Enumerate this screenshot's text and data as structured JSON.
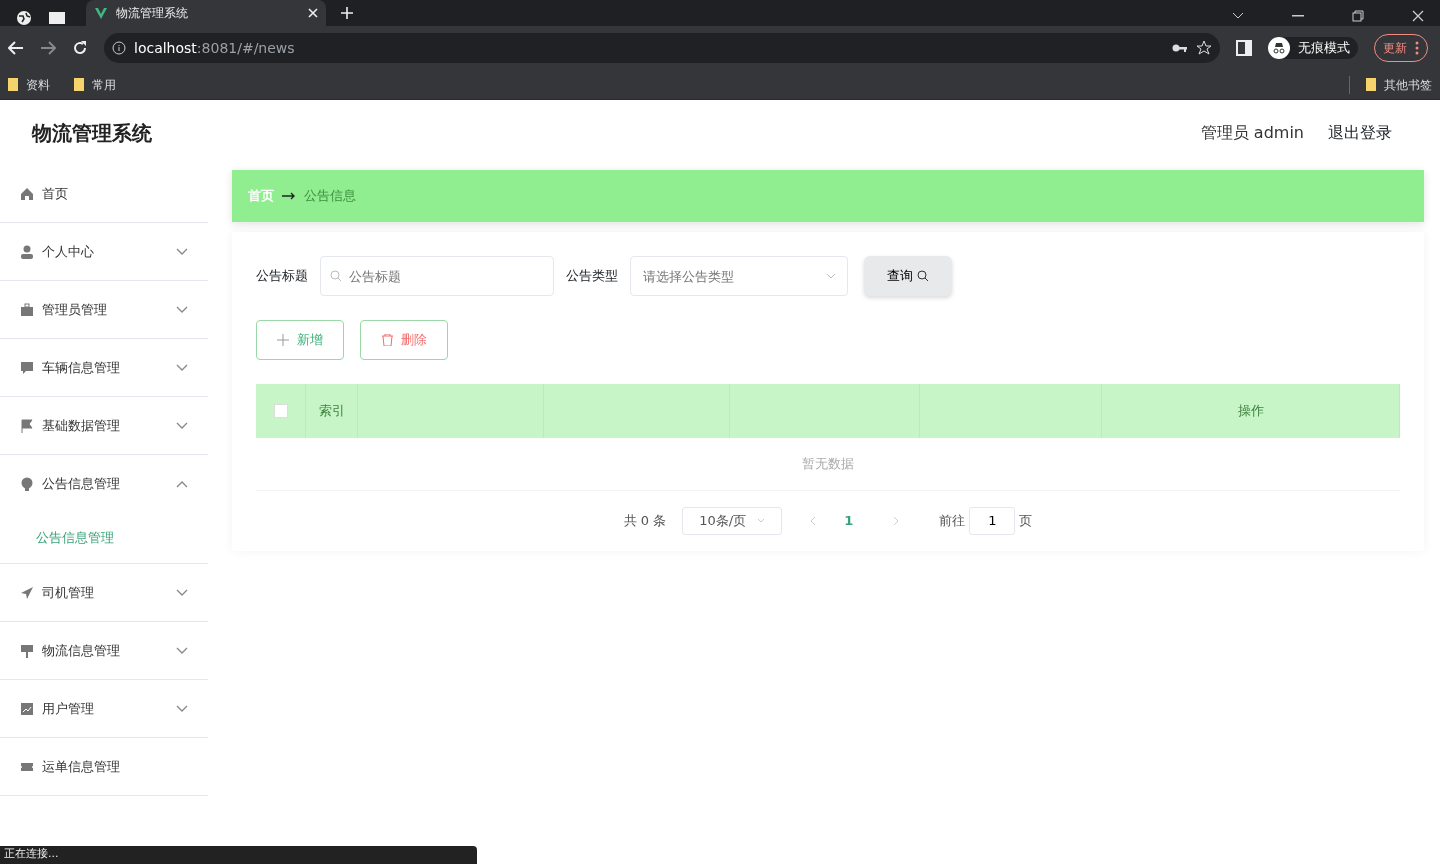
{
  "browser": {
    "tab_title": "物流管理系统",
    "url_host": "localhost",
    "url_path": ":8081/#/news",
    "bookmarks": [
      "资料",
      "常用"
    ],
    "profile": "无痕模式",
    "update_button": "更新",
    "other_bookmarks": "其他书签"
  },
  "header": {
    "title": "物流管理系统",
    "user": "管理员 admin",
    "logout": "退出登录"
  },
  "sidebar": {
    "items": [
      {
        "label": "首页",
        "kind": "link"
      },
      {
        "label": "个人中心",
        "kind": "menu",
        "expanded": false
      },
      {
        "label": "管理员管理",
        "kind": "menu",
        "expanded": false
      },
      {
        "label": "车辆信息管理",
        "kind": "menu",
        "expanded": false
      },
      {
        "label": "基础数据管理",
        "kind": "menu",
        "expanded": false
      },
      {
        "label": "公告信息管理",
        "kind": "menu",
        "expanded": true,
        "children": [
          {
            "label": "公告信息管理",
            "selected": true
          }
        ]
      },
      {
        "label": "司机管理",
        "kind": "menu",
        "expanded": false
      },
      {
        "label": "物流信息管理",
        "kind": "menu",
        "expanded": false
      },
      {
        "label": "用户管理",
        "kind": "menu",
        "expanded": false
      },
      {
        "label": "运单信息管理",
        "kind": "link"
      }
    ]
  },
  "breadcrumb": [
    "首页",
    "公告信息"
  ],
  "search": {
    "fields": [
      {
        "label": "公告标题",
        "placeholder": "公告标题",
        "kind": "text"
      },
      {
        "label": "公告类型",
        "placeholder": "请选择公告类型",
        "kind": "select"
      }
    ],
    "query_button": "查询"
  },
  "actions": [
    {
      "label": "新增",
      "kind": "add"
    },
    {
      "label": "删除",
      "kind": "delete"
    }
  ],
  "table": {
    "columns": [
      {
        "kind": "checkbox"
      },
      {
        "kind": "text",
        "label": "索引"
      },
      {
        "kind": "text"
      },
      {
        "kind": "text"
      },
      {
        "kind": "text"
      },
      {
        "kind": "text"
      },
      {
        "kind": "text",
        "label": "操作"
      }
    ],
    "select_all": {
      "checked": false
    },
    "empty_text": "暂无数据"
  },
  "pagination": {
    "total": "共 0 条",
    "page_size": "10条/页",
    "pages": [
      {
        "label": "1",
        "selected": true
      }
    ],
    "goto_label": "前往",
    "goto_value": "1",
    "goto_suffix": "页"
  },
  "status_bar": "正在连接..."
}
